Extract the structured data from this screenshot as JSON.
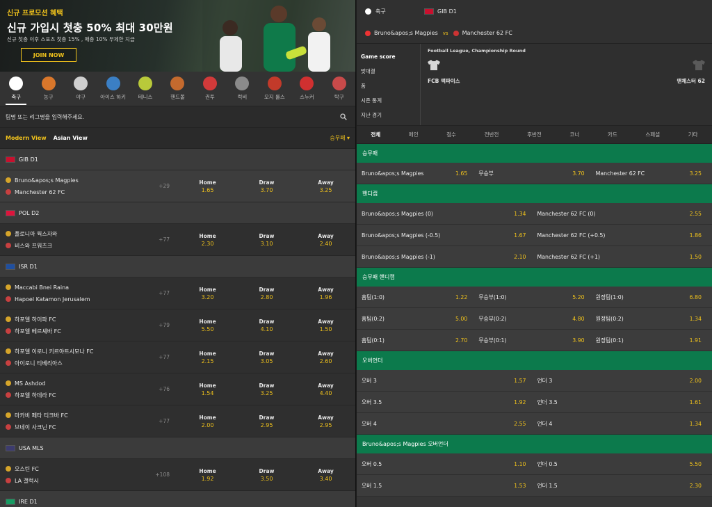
{
  "banner": {
    "tag": "신규 프로모션 혜택",
    "title": "신규 가입시 첫충 50% 최대 30만원",
    "subtitle": "신규 첫충 이후 스포츠 첫충 15% , 매충 10% 무제한 지급",
    "join": "JOIN NOW"
  },
  "sports": [
    {
      "label": "축구",
      "icon": "soccer-ball-icon",
      "color": "#ffffff"
    },
    {
      "label": "농구",
      "icon": "basketball-icon",
      "color": "#d9772b"
    },
    {
      "label": "야구",
      "icon": "baseball-icon",
      "color": "#cfcfcf"
    },
    {
      "label": "아이스 하키",
      "icon": "ice-hockey-icon",
      "color": "#3b7fc4"
    },
    {
      "label": "테니스",
      "icon": "tennis-ball-icon",
      "color": "#b9c93a"
    },
    {
      "label": "핸드볼",
      "icon": "handball-icon",
      "color": "#c46a2e"
    },
    {
      "label": "권투",
      "icon": "boxing-glove-icon",
      "color": "#d13a3a"
    },
    {
      "label": "럭비",
      "icon": "rugby-ball-icon",
      "color": "#8a8a8a"
    },
    {
      "label": "오지 룰스",
      "icon": "aussie-rules-icon",
      "color": "#c23a2a"
    },
    {
      "label": "스누커",
      "icon": "snooker-icon",
      "color": "#d03030"
    },
    {
      "label": "탁구",
      "icon": "table-tennis-icon",
      "color": "#c84a4a"
    }
  ],
  "search": {
    "placeholder": "팀명 또는 리그명을 입력해주세요."
  },
  "views": {
    "modern": "Modern View",
    "asian": "Asian View",
    "market": "승무패"
  },
  "leagues": [
    {
      "name": "GIB D1",
      "flag": "#c8102e",
      "matches": [
        {
          "home": "Bruno&apos;s Magpies",
          "away": "Manchester 62 FC",
          "more": "+29",
          "odds": [
            "1.65",
            "3.70",
            "3.25"
          ],
          "sel": true
        }
      ]
    },
    {
      "name": "POL D2",
      "flag": "#dc143c",
      "matches": [
        {
          "home": "폴로니아 웍스자와",
          "away": "비스와 프워츠크",
          "more": "+77",
          "odds": [
            "2.30",
            "3.10",
            "2.40"
          ]
        }
      ]
    },
    {
      "name": "ISR D1",
      "flag": "#1f4fa0",
      "matches": [
        {
          "home": "Maccabi Bnei Raina",
          "away": "Hapoel Katamon Jerusalem",
          "more": "+77",
          "odds": [
            "3.20",
            "2.80",
            "1.96"
          ]
        },
        {
          "home": "하포엘 하이파 FC",
          "away": "하포엘 베르셰바 FC",
          "more": "+79",
          "odds": [
            "5.50",
            "4.10",
            "1.50"
          ]
        },
        {
          "home": "하포엘 이로니 키르야트시모나 FC",
          "away": "아이로니 티베리아스",
          "more": "+77",
          "odds": [
            "2.15",
            "3.05",
            "2.60"
          ]
        },
        {
          "home": "MS Ashdod",
          "away": "하포엘 하데라 FC",
          "more": "+76",
          "odds": [
            "1.54",
            "3.25",
            "4.40"
          ]
        },
        {
          "home": "마카비 페타 티크바 FC",
          "away": "브네이 사크닌 FC",
          "more": "+77",
          "odds": [
            "2.00",
            "2.95",
            "2.95"
          ]
        }
      ]
    },
    {
      "name": "USA MLS",
      "flag": "#3c3b6e",
      "matches": [
        {
          "home": "오스틴 FC",
          "away": "LA 갤럭시",
          "more": "+108",
          "odds": [
            "1.92",
            "3.50",
            "3.40"
          ]
        }
      ]
    },
    {
      "name": "IRE D1",
      "flag": "#169b62",
      "matches": []
    }
  ],
  "odds_labels": [
    "Home",
    "Draw",
    "Away"
  ],
  "detail": {
    "sport": "축구",
    "league": "GIB D1",
    "home": "Bruno&apos;s Magpies",
    "vs": "vs",
    "away": "Manchester 62 FC",
    "round": "Football League, Championship Round",
    "home_short": "FCB 맥파이스",
    "away_short": "맨체스터 62",
    "menu": [
      "Game score",
      "맞대결",
      "폼",
      "시즌 통계",
      "지난 경기"
    ],
    "tabs": [
      "전체",
      "메인",
      "점수",
      "전반전",
      "후반전",
      "코너",
      "카드",
      "스페셜",
      "기타"
    ]
  },
  "sections": [
    {
      "title": "승무패",
      "cols": 3,
      "rows": [
        [
          [
            "Bruno&apos;s Magpies",
            "1.65"
          ],
          [
            "무승부",
            "3.70"
          ],
          [
            "Manchester 62 FC",
            "3.25"
          ]
        ]
      ]
    },
    {
      "title": "핸디캡",
      "cols": 2,
      "rows": [
        [
          [
            "Bruno&apos;s Magpies (0)",
            "1.34"
          ],
          [
            "Manchester 62 FC (0)",
            "2.55"
          ]
        ],
        [
          [
            "Bruno&apos;s Magpies (-0.5)",
            "1.67"
          ],
          [
            "Manchester 62 FC (+0.5)",
            "1.86"
          ]
        ],
        [
          [
            "Bruno&apos;s Magpies (-1)",
            "2.10"
          ],
          [
            "Manchester 62 FC (+1)",
            "1.50"
          ]
        ]
      ]
    },
    {
      "title": "승무패 핸디캡",
      "cols": 3,
      "rows": [
        [
          [
            "홈팀(1:0)",
            "1.22"
          ],
          [
            "무승부(1:0)",
            "5.20"
          ],
          [
            "원정팀(1:0)",
            "6.80"
          ]
        ],
        [
          [
            "홈팀(0:2)",
            "5.00"
          ],
          [
            "무승부(0:2)",
            "4.80"
          ],
          [
            "원정팀(0:2)",
            "1.34"
          ]
        ],
        [
          [
            "홈팀(0:1)",
            "2.70"
          ],
          [
            "무승부(0:1)",
            "3.90"
          ],
          [
            "원정팀(0:1)",
            "1.91"
          ]
        ]
      ]
    },
    {
      "title": "오버언더",
      "cols": 2,
      "rows": [
        [
          [
            "오버 3",
            "1.57"
          ],
          [
            "언더 3",
            "2.00"
          ]
        ],
        [
          [
            "오버 3.5",
            "1.92"
          ],
          [
            "언더 3.5",
            "1.61"
          ]
        ],
        [
          [
            "오버 4",
            "2.55"
          ],
          [
            "언더 4",
            "1.34"
          ]
        ]
      ]
    },
    {
      "title": "Bruno&apos;s Magpies 오버언더",
      "cols": 2,
      "rows": [
        [
          [
            "오버 0.5",
            "1.10"
          ],
          [
            "언더 0.5",
            "5.50"
          ]
        ],
        [
          [
            "오버 1.5",
            "1.53"
          ],
          [
            "언더 1.5",
            "2.30"
          ]
        ]
      ]
    }
  ]
}
